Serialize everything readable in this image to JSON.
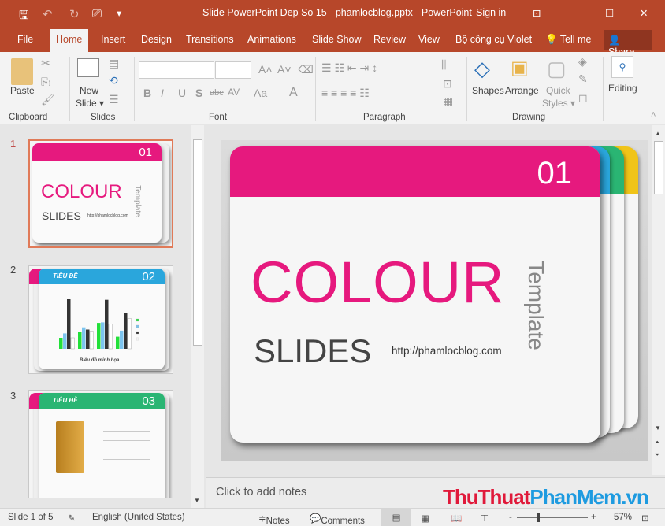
{
  "window": {
    "title": "Slide PowerPoint Dep So 15 - phamlocblog.pptx  -  PowerPoint",
    "sign_in": "Sign in",
    "minimize": "–",
    "maximize": "☐",
    "close": "✕",
    "restore": "⊡"
  },
  "qat": {
    "save": "🖫",
    "undo": "↶",
    "redo": "↻",
    "present": "⎚",
    "more": "▾"
  },
  "tabs": [
    "File",
    "Home",
    "Insert",
    "Design",
    "Transitions",
    "Animations",
    "Slide Show",
    "Review",
    "View",
    "Bộ công cụ Violet",
    "Tell me",
    "Share"
  ],
  "ribbon": {
    "paste": "Paste",
    "new_slide": "New",
    "new_slide2": "Slide ▾",
    "shapes": "Shapes",
    "arrange": "Arrange",
    "quick": "Quick",
    "styles": "Styles ▾",
    "editing": "Editing",
    "groups": [
      "Clipboard",
      "Slides",
      "Font",
      "Paragraph",
      "Drawing"
    ],
    "font_buttons": [
      "B",
      "I",
      "U",
      "S",
      "abc",
      "AV",
      "Aa",
      "A"
    ]
  },
  "thumbnails": [
    {
      "num": "1",
      "big": "COLOUR",
      "small": "SLIDES",
      "url": "http://phamlocblog.com",
      "side": "Template",
      "badge": "01"
    },
    {
      "num": "2",
      "title": "TIÊU ĐỀ",
      "badge": "02",
      "caption": "Biểu đồ minh họa"
    },
    {
      "num": "3",
      "title": "TIÊU ĐỀ",
      "badge": "03"
    }
  ],
  "slide": {
    "badge": "01",
    "title": "COLOUR",
    "subtitle": "SLIDES",
    "url": "http://phamlocblog.com",
    "side": "Template"
  },
  "notes_placeholder": "Click to add notes",
  "watermark": {
    "a": "ThuThuat",
    "b": "PhanMem",
    "c": ".vn"
  },
  "status": {
    "slide": "Slide 1 of 5",
    "language": "English (United States)",
    "notes": "Notes",
    "comments": "Comments",
    "zoom": "57%",
    "zoom_level": 57
  },
  "colors": {
    "accent": "#b7472a",
    "pink": "#e6197e",
    "blue": "#2aa6dc",
    "green": "#2ab573",
    "yellow": "#f0c419"
  },
  "chart_thumb": {
    "series_colors": [
      "#22e03a",
      "#7cc4ef",
      "#333333",
      "#ffffff"
    ],
    "values": [
      [
        20,
        28,
        90,
        20
      ],
      [
        31,
        39,
        35,
        32
      ],
      [
        47,
        48,
        89,
        45
      ],
      [
        22,
        33,
        65,
        55
      ]
    ]
  }
}
